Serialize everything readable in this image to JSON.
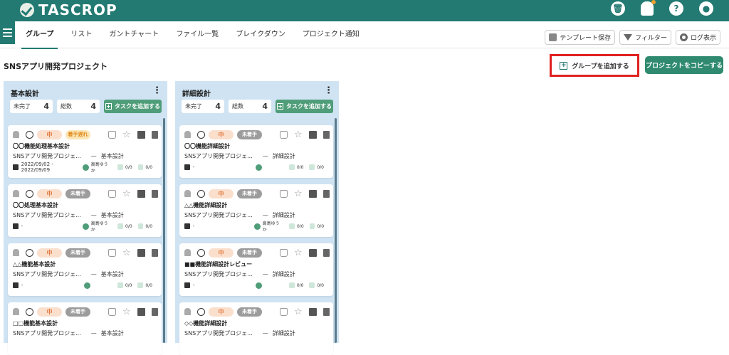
{
  "app": {
    "logo": "TASCROP"
  },
  "top_icons": [
    {
      "name": "trash-icon",
      "glyph": "🗑"
    },
    {
      "name": "bell-icon",
      "glyph": ""
    },
    {
      "name": "help-icon",
      "glyph": "?"
    },
    {
      "name": "user-icon",
      "glyph": "●"
    }
  ],
  "colors": {
    "brand": "#227a72",
    "accent": "#2f8a70",
    "highlight": "#e02020"
  },
  "nav": {
    "tabs": [
      "グループ",
      "リスト",
      "ガントチャート",
      "ファイル一覧",
      "ブレイクダウン",
      "プロジェクト通知"
    ],
    "active": 0
  },
  "toolbar": {
    "template_save": "テンプレート保存",
    "filter": "フィルター",
    "log": "ログ表示"
  },
  "project": {
    "title": "SNSアプリ開発プロジェクト",
    "add_group": "グループを追加する",
    "copy_project": "プロジェクトをコピーする"
  },
  "columns": [
    {
      "title": "基本設計",
      "incomplete_label": "未完了",
      "incomplete": "4",
      "total_label": "総数",
      "total": "4",
      "add_task": "タスクを追加する",
      "cards": [
        {
          "priority": "中",
          "status": "着手遅れ",
          "status_type": "warn",
          "name": "〇〇機能処理基本設計",
          "project": "SNSアプリ開発プロジェ...",
          "sep": "—",
          "group": "基本設計",
          "dates": "2022/09/02 - 2022/09/09",
          "assignee": "高島ゆうか",
          "v1": "0/0",
          "v2": "0/0"
        },
        {
          "priority": "中",
          "status": "未着手",
          "status_type": "grey",
          "name": "〇〇処理基本設計",
          "project": "SNSアプリ開発プロジェ...",
          "sep": "—",
          "group": "基本設計",
          "dates": "-",
          "assignee": "高島ゆうか",
          "v1": "0/0",
          "v2": "0/0"
        },
        {
          "priority": "中",
          "status": "未着手",
          "status_type": "grey",
          "name": "△△機能基本設計",
          "project": "SNSアプリ開発プロジェ...",
          "sep": "—",
          "group": "基本設計",
          "dates": "-",
          "assignee": "",
          "v1": "0/0",
          "v2": "0/0"
        },
        {
          "priority": "中",
          "status": "未着手",
          "status_type": "grey",
          "name": "□□機能基本設計",
          "project": "SNSアプリ開発プロジェ...",
          "sep": "—",
          "group": "基本設計",
          "dates": "",
          "assignee": "",
          "v1": "",
          "v2": ""
        }
      ]
    },
    {
      "title": "詳細設計",
      "incomplete_label": "未完了",
      "incomplete": "4",
      "total_label": "総数",
      "total": "4",
      "add_task": "タスクを追加する",
      "cards": [
        {
          "priority": "中",
          "status": "未着手",
          "status_type": "grey",
          "name": "〇〇機能詳細設計",
          "project": "SNSアプリ開発プロジェ...",
          "sep": "—",
          "group": "詳細設計",
          "dates": "-",
          "assignee": "",
          "v1": "0/0",
          "v2": "0/0"
        },
        {
          "priority": "中",
          "status": "未着手",
          "status_type": "grey",
          "name": "△△機能詳細設計",
          "project": "SNSアプリ開発プロジェ...",
          "sep": "—",
          "group": "詳細設計",
          "dates": "-",
          "assignee": "高島ゆうか",
          "v1": "0/0",
          "v2": "0/0"
        },
        {
          "priority": "中",
          "status": "未着手",
          "status_type": "grey",
          "name": "■■機能詳細設計レビュー",
          "project": "SNSアプリ開発プロジェ...",
          "sep": "—",
          "group": "詳細設計",
          "dates": "-",
          "assignee": "",
          "v1": "0/0",
          "v2": "0/0"
        },
        {
          "priority": "中",
          "status": "未着手",
          "status_type": "grey",
          "name": "◇◇機能詳細設計",
          "project": "SNSアプリ開発プロジェ...",
          "sep": "—",
          "group": "詳細設計",
          "dates": "",
          "assignee": "",
          "v1": "",
          "v2": ""
        }
      ]
    }
  ]
}
